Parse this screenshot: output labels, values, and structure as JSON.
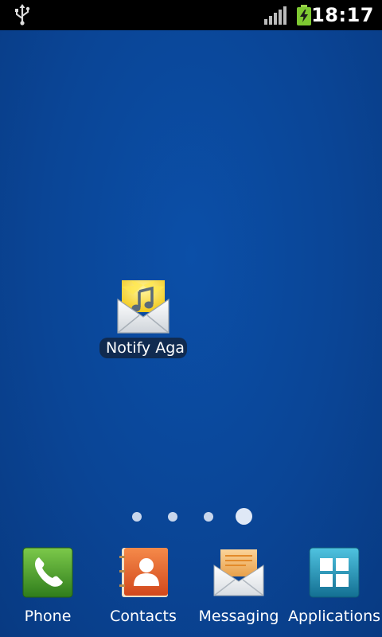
{
  "status_bar": {
    "time": "18:17",
    "icons": [
      "usb-icon",
      "signal-strength-icon",
      "battery-charging-icon"
    ]
  },
  "desktop": {
    "shortcuts": [
      {
        "label": "Notify Aga",
        "icon": "notify-again-icon"
      }
    ],
    "page_indicator": {
      "pages": 4,
      "current": 4
    }
  },
  "dock": {
    "items": [
      {
        "label": "Phone",
        "icon": "phone-icon"
      },
      {
        "label": "Contacts",
        "icon": "contacts-icon"
      },
      {
        "label": "Messaging",
        "icon": "messaging-icon"
      },
      {
        "label": "Applications",
        "icon": "applications-icon"
      }
    ]
  },
  "colors": {
    "wallpaper": "#0a4596",
    "status_bar": "#000000",
    "phone_green": "#4aa02c",
    "contacts_orange": "#e8642a",
    "apps_teal": "#1d8fb0",
    "battery_green": "#7ec832"
  }
}
